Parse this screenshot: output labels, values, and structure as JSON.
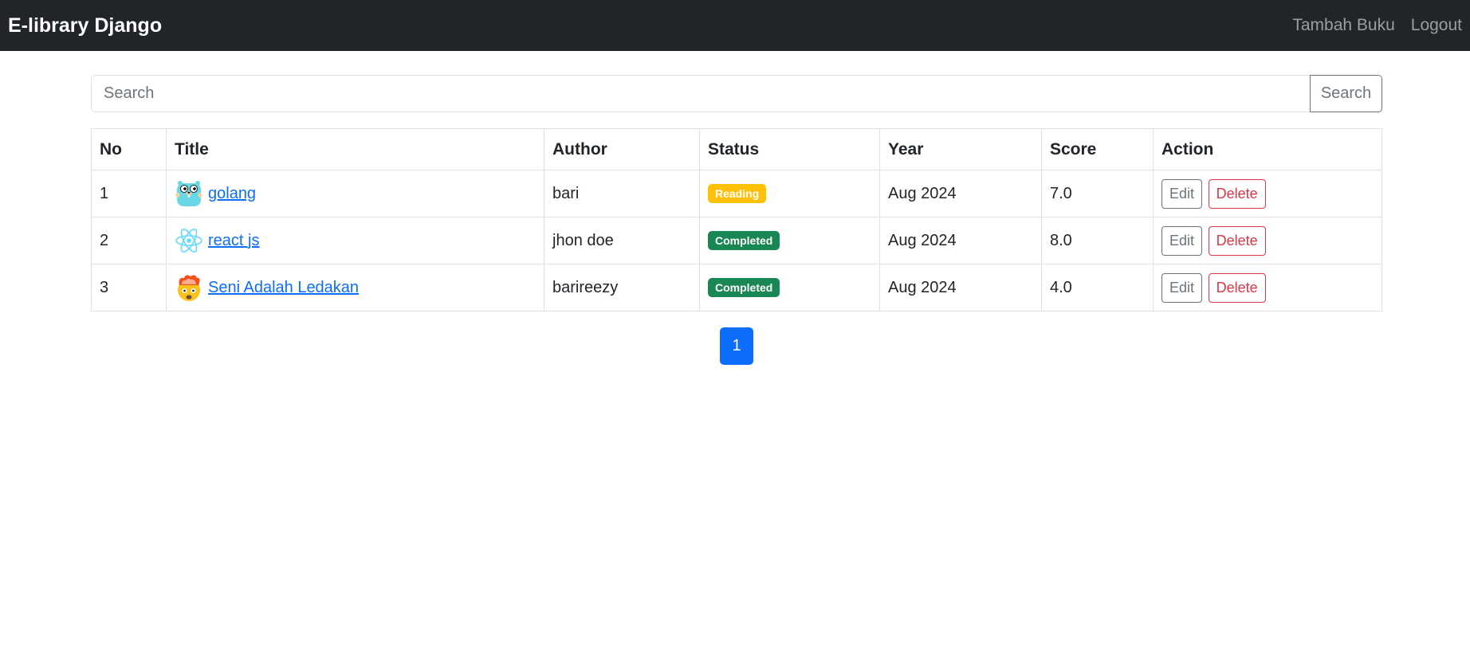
{
  "navbar": {
    "brand": "E-library Django",
    "links": [
      "Tambah Buku",
      "Logout"
    ]
  },
  "search": {
    "placeholder": "Search",
    "value": "",
    "button_label": "Search"
  },
  "table": {
    "headers": [
      "No",
      "Title",
      "Author",
      "Status",
      "Year",
      "Score",
      "Action"
    ],
    "rows": [
      {
        "no": "1",
        "icon": "gopher-icon",
        "title": "golang",
        "author": "bari",
        "status": "Reading",
        "status_color": "#ffc107",
        "year": "Aug 2024",
        "score": "7.0",
        "edit_label": "Edit",
        "delete_label": "Delete"
      },
      {
        "no": "2",
        "icon": "react-icon",
        "title": "react js",
        "author": "jhon doe",
        "status": "Completed",
        "status_color": "#198754",
        "year": "Aug 2024",
        "score": "8.0",
        "edit_label": "Edit",
        "delete_label": "Delete"
      },
      {
        "no": "3",
        "icon": "exploding-head-icon",
        "title": "Seni Adalah Ledakan",
        "author": "barireezy",
        "status": "Completed",
        "status_color": "#198754",
        "year": "Aug 2024",
        "score": "4.0",
        "edit_label": "Edit",
        "delete_label": "Delete"
      }
    ]
  },
  "pagination": {
    "current_page": "1"
  },
  "colors": {
    "navbar_bg": "#212529",
    "link": "#0d6efd",
    "primary": "#0d6efd",
    "danger": "#dc3545"
  }
}
